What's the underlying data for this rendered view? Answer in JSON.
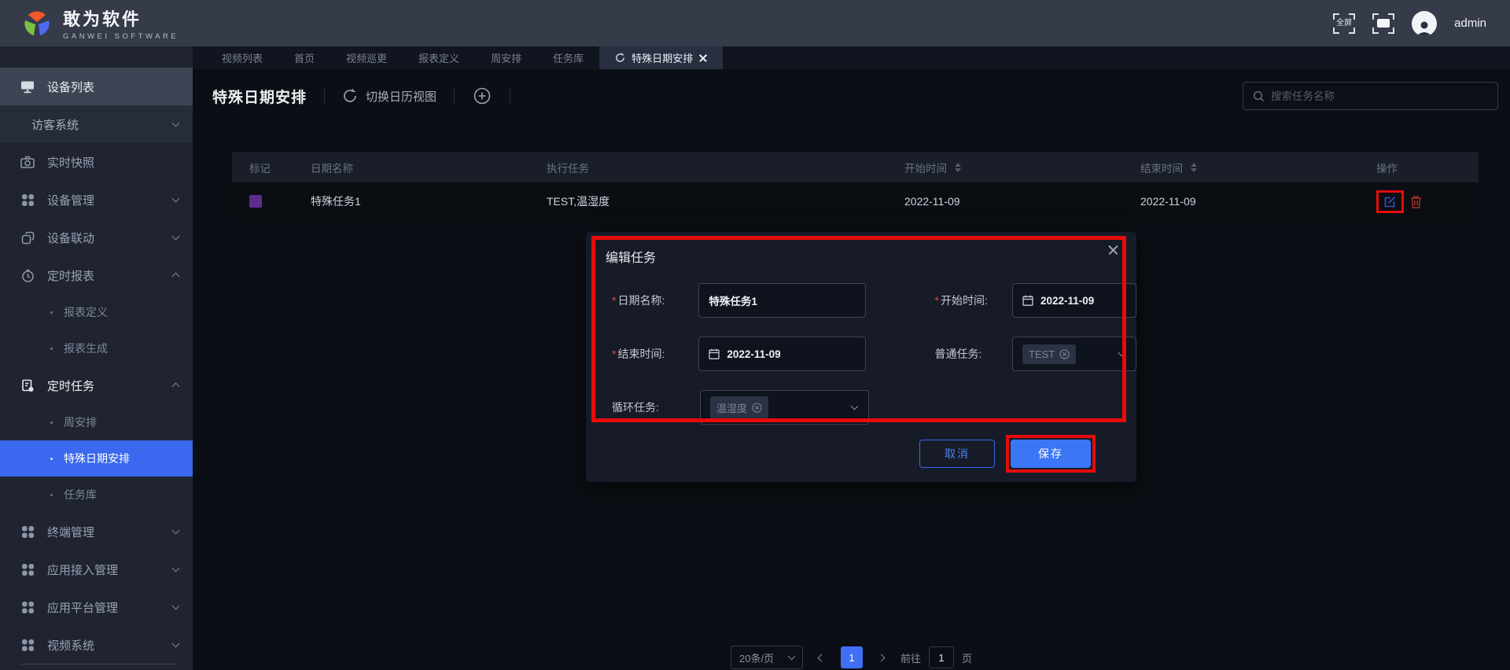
{
  "header": {
    "brand": "敢为软件",
    "brand_sub": "GANWEI  SOFTWARE",
    "fullscreen_label": "全屏",
    "username": "admin"
  },
  "tabs": {
    "items": [
      {
        "label": "视频列表"
      },
      {
        "label": "首页"
      },
      {
        "label": "视频巡更"
      },
      {
        "label": "报表定义"
      },
      {
        "label": "周安排"
      },
      {
        "label": "任务库"
      },
      {
        "label": "特殊日期安排",
        "active": true,
        "closable": true
      }
    ]
  },
  "sidebar": {
    "items": [
      {
        "label": "设备列表",
        "icon": "monitor-icon",
        "highlighted": true
      },
      {
        "label": "访客系统",
        "expandable": true
      },
      {
        "label": "实时快照",
        "icon": "camera-icon"
      },
      {
        "label": "设备管理",
        "icon": "grid-icon",
        "expandable": true
      },
      {
        "label": "设备联动",
        "icon": "link-icon",
        "expandable": true
      },
      {
        "label": "定时报表",
        "icon": "clock-icon",
        "expanded": true
      },
      {
        "label": "报表定义",
        "sub": true
      },
      {
        "label": "报表生成",
        "sub": true
      },
      {
        "label": "定时任务",
        "icon": "task-icon",
        "expanded": true,
        "active_parent": true
      },
      {
        "label": "周安排",
        "sub": true
      },
      {
        "label": "特殊日期安排",
        "sub": true,
        "active": true
      },
      {
        "label": "任务库",
        "sub": true
      },
      {
        "label": "终端管理",
        "icon": "grid-icon",
        "expandable": true
      },
      {
        "label": "应用接入管理",
        "icon": "grid-icon",
        "expandable": true
      },
      {
        "label": "应用平台管理",
        "icon": "grid-icon",
        "expandable": true
      },
      {
        "label": "视频系统",
        "icon": "grid-icon",
        "expandable": true
      }
    ]
  },
  "toolbar": {
    "title": "特殊日期安排",
    "switch_view_label": "切换日历视图",
    "search_placeholder": "搜索任务名称"
  },
  "table": {
    "headers": {
      "mark": "标记",
      "name": "日期名称",
      "tasks": "执行任务",
      "start": "开始时间",
      "end": "结束时间",
      "actions": "操作"
    },
    "rows": [
      {
        "mark_color": "#5b2d90",
        "name": "特殊任务1",
        "tasks": "TEST,温湿度",
        "start": "2022-11-09",
        "end": "2022-11-09"
      }
    ]
  },
  "modal": {
    "title": "编辑任务",
    "required_mark": "*",
    "fields": [
      {
        "label": "日期名称:",
        "required": true,
        "value": "特殊任务1",
        "type": "text"
      },
      {
        "label": "开始时间:",
        "required": true,
        "value": "2022-11-09",
        "type": "date"
      },
      {
        "label": "结束时间:",
        "required": true,
        "value": "2022-11-09",
        "type": "date"
      },
      {
        "label": "普通任务:",
        "required": false,
        "tag": "TEST",
        "type": "select"
      },
      {
        "label": "循环任务:",
        "required": false,
        "tag": "温湿度",
        "type": "select"
      }
    ],
    "cancel_label": "取消",
    "save_label": "保存"
  },
  "pagination": {
    "page_size": "20条/页",
    "current_page": "1",
    "goto_label": "前往",
    "goto_value": "1",
    "page_unit": "页"
  },
  "colors": {
    "annotation_red": "#e60c0b",
    "accent_blue": "#3b76f6",
    "sidebar_active_blue": "#3a68ee",
    "row_mark_purple": "#5b2d90",
    "header_bg": "#353b49",
    "sidebar_bg": "#1f2430",
    "content_bg": "#0b0e14",
    "modal_bg": "#161b27"
  }
}
